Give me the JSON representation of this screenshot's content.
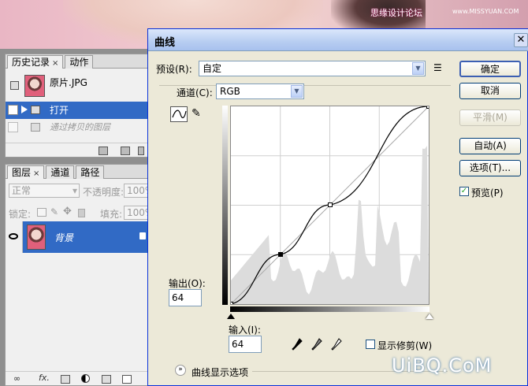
{
  "watermark": {
    "text": "思缘设计论坛",
    "url": "www.MISSYUAN.COM"
  },
  "history": {
    "tabs": [
      "历史记录",
      "动作"
    ],
    "snapshot": "原片.JPG",
    "items": [
      "打开",
      "通过拷贝的图层"
    ]
  },
  "layers": {
    "tabs": [
      "图层",
      "通道",
      "路径"
    ],
    "blend_mode": "正常",
    "opacity_label": "不透明度:",
    "opacity_value": "100%",
    "lock_label": "锁定:",
    "fill_label": "填充:",
    "fill_value": "100%",
    "layer_name": "背景"
  },
  "dialog": {
    "title": "曲线",
    "preset_label": "预设(R):",
    "preset_value": "自定",
    "channel_label": "通道(C):",
    "channel_value": "RGB",
    "output_label": "输出(O):",
    "output_value": "64",
    "input_label": "输入(I):",
    "input_value": "64",
    "show_clipping": "显示修剪(W)",
    "curve_options": "曲线显示选项",
    "buttons": {
      "ok": "确定",
      "cancel": "取消",
      "smooth": "平滑(M)",
      "auto": "自动(A)",
      "options": "选项(T)...",
      "preview": "预览(P)"
    },
    "preview_checked": true
  },
  "curve": {
    "points": [
      [
        0,
        0
      ],
      [
        64,
        64
      ],
      [
        128,
        128
      ],
      [
        255,
        255
      ]
    ]
  },
  "logo": "UiBQ.CoM"
}
